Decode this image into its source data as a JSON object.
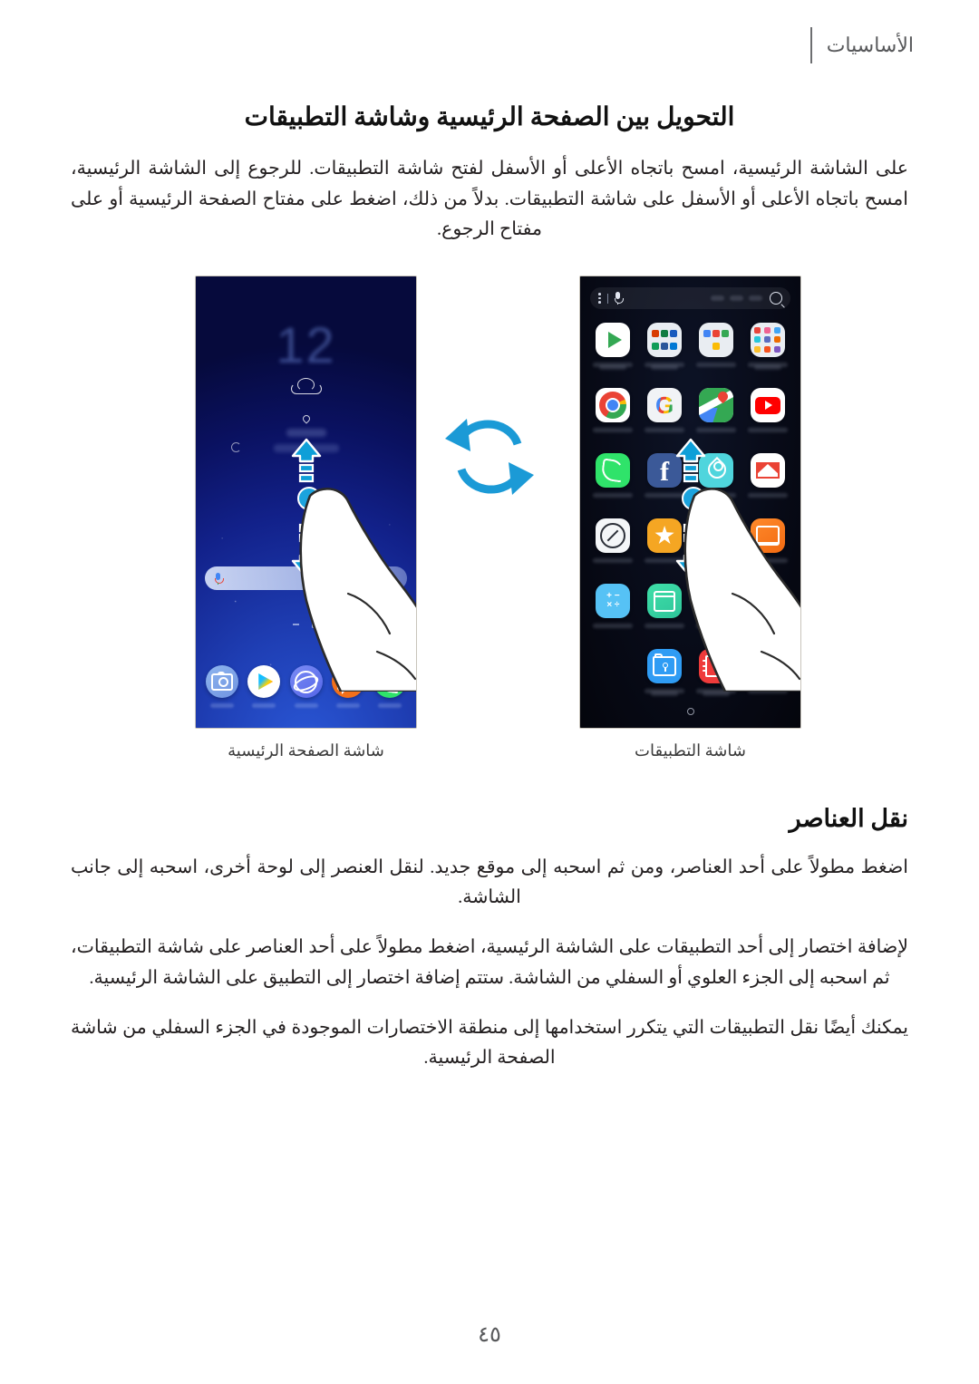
{
  "header": {
    "chapter": "الأساسيات"
  },
  "main": {
    "section_title": "التحويل بين الصفحة الرئيسية وشاشة التطبيقات",
    "intro_paragraph": "على الشاشة الرئيسية، امسح باتجاه الأعلى أو الأسفل لفتح شاشة التطبيقات. للرجوع إلى الشاشة الرئيسية، امسح باتجاه الأعلى أو الأسفل على شاشة التطبيقات. بدلاً من ذلك، اضغط على مفتاح الصفحة الرئيسية أو على مفتاح الرجوع.",
    "sub_title": "نقل العناصر",
    "paragraphs": [
      "اضغط مطولاً على أحد العناصر، ومن ثم اسحبه إلى موقع جديد. لنقل العنصر إلى لوحة أخرى، اسحبه إلى جانب الشاشة.",
      "لإضافة اختصار إلى أحد التطبيقات على الشاشة الرئيسية، اضغط مطولاً على أحد العناصر على شاشة التطبيقات، ثم اسحبه إلى الجزء العلوي أو السفلي من الشاشة. ستتم إضافة اختصار إلى التطبيق على الشاشة الرئيسية.",
      "يمكنك أيضًا نقل التطبيقات التي يتكرر استخدامها إلى منطقة الاختصارات الموجودة في الجزء السفلي من شاشة الصفحة الرئيسية."
    ]
  },
  "figure": {
    "swap_icon": "swap-arrows-icon",
    "apps_screen": {
      "caption": "شاشة التطبيقات",
      "search_bar": {
        "menu_icon": "more-options-icon",
        "mic_icon": "microphone-icon",
        "search_icon": "search-icon"
      },
      "apps": [
        {
          "name": "play-store",
          "icon": "play-store-icon"
        },
        {
          "name": "microsoft-folder",
          "icon": "folder-icon"
        },
        {
          "name": "google-folder",
          "icon": "folder-icon"
        },
        {
          "name": "samsung-folder",
          "icon": "folder-icon"
        },
        {
          "name": "chrome",
          "icon": "chrome-icon"
        },
        {
          "name": "google",
          "icon": "google-icon"
        },
        {
          "name": "maps",
          "icon": "maps-icon"
        },
        {
          "name": "youtube",
          "icon": "youtube-icon"
        },
        {
          "name": "phone",
          "icon": "phone-icon"
        },
        {
          "name": "facebook",
          "icon": "facebook-icon"
        },
        {
          "name": "samsung-health",
          "icon": "health-icon"
        },
        {
          "name": "gmail",
          "icon": "gmail-icon"
        },
        {
          "name": "clock",
          "icon": "clock-icon"
        },
        {
          "name": "galaxy-store",
          "icon": "galaxy-store-icon"
        },
        {
          "name": "blue-app",
          "icon": "app-icon"
        },
        {
          "name": "orange-app",
          "icon": "app-icon"
        },
        {
          "name": "calculator",
          "icon": "calculator-icon"
        },
        {
          "name": "calendar",
          "icon": "calendar-icon"
        },
        {
          "name": "settings",
          "icon": "gear-icon"
        },
        {
          "name": "empty-slot",
          "icon": "none"
        },
        {
          "name": "empty-slot",
          "icon": "none"
        },
        {
          "name": "secure-folder",
          "icon": "secure-folder-icon"
        },
        {
          "name": "samsung-notes",
          "icon": "notes-icon"
        },
        {
          "name": "play-music",
          "icon": "music-icon"
        }
      ],
      "page_indicator": "page-dot"
    },
    "home_screen": {
      "caption": "شاشة الصفحة الرئيسية",
      "clock_widget": "12",
      "weather_icon": "cloud-icon",
      "location_icon": "location-pin-icon",
      "refresh_icon": "refresh-icon",
      "google_bar": {
        "mic_icon": "microphone-icon"
      },
      "dock": [
        {
          "name": "camera",
          "icon": "camera-icon"
        },
        {
          "name": "play-store",
          "icon": "play-store-icon"
        },
        {
          "name": "internet",
          "icon": "globe-icon"
        },
        {
          "name": "messages",
          "icon": "message-bubble-icon"
        },
        {
          "name": "phone",
          "icon": "phone-icon"
        }
      ]
    },
    "gesture": {
      "swipe_up_icon": "arrow-up-icon",
      "swipe_down_icon": "arrow-down-icon",
      "touch_point": "touch-indicator",
      "hand": "hand-icon"
    }
  },
  "footer": {
    "page_number": "٤٥"
  },
  "colors": {
    "accent_blue": "#0e9fd8",
    "touch_blue": "#1ba3de",
    "header_gray": "#58595b",
    "text": "#231f20"
  }
}
